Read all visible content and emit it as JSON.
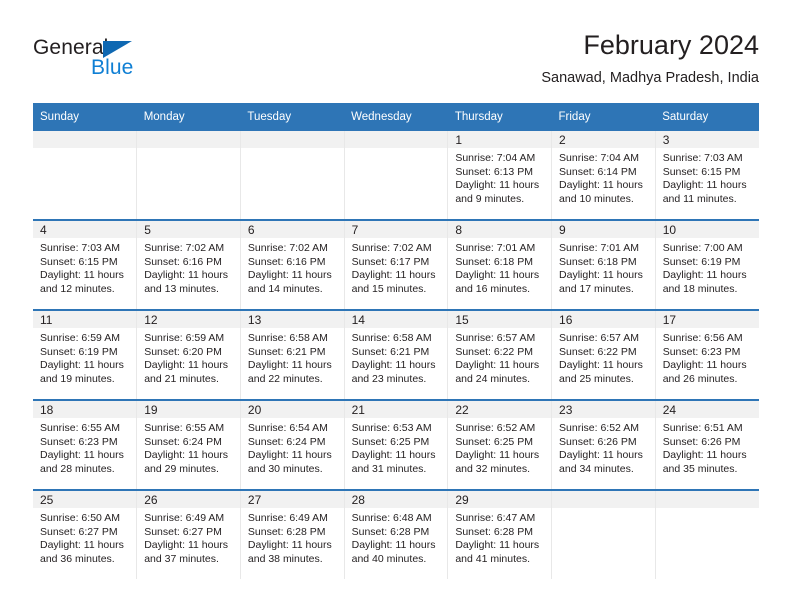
{
  "brand": {
    "word_one": "General",
    "word_two": "Blue",
    "triangle_icon": "blue-triangle-icon",
    "colors": {
      "general_text": "#231f20",
      "blue_text": "#0f7fd4",
      "triangle": "#0f68b2"
    }
  },
  "header": {
    "title": "February 2024",
    "subtitle": "Sanawad, Madhya Pradesh, India"
  },
  "theme": {
    "header_blue": "#2e75b6",
    "daynum_band": "#f1f1f1",
    "text": "#231f20",
    "grid_line": "#e8e8e8"
  },
  "calendar": {
    "weekday_headers": [
      "Sunday",
      "Monday",
      "Tuesday",
      "Wednesday",
      "Thursday",
      "Friday",
      "Saturday"
    ],
    "weeks": [
      [
        {
          "empty": true
        },
        {
          "empty": true
        },
        {
          "empty": true
        },
        {
          "empty": true
        },
        {
          "day": "1",
          "sunrise": "Sunrise: 7:04 AM",
          "sunset": "Sunset: 6:13 PM",
          "daylight": "Daylight: 11 hours and 9 minutes."
        },
        {
          "day": "2",
          "sunrise": "Sunrise: 7:04 AM",
          "sunset": "Sunset: 6:14 PM",
          "daylight": "Daylight: 11 hours and 10 minutes."
        },
        {
          "day": "3",
          "sunrise": "Sunrise: 7:03 AM",
          "sunset": "Sunset: 6:15 PM",
          "daylight": "Daylight: 11 hours and 11 minutes."
        }
      ],
      [
        {
          "day": "4",
          "sunrise": "Sunrise: 7:03 AM",
          "sunset": "Sunset: 6:15 PM",
          "daylight": "Daylight: 11 hours and 12 minutes."
        },
        {
          "day": "5",
          "sunrise": "Sunrise: 7:02 AM",
          "sunset": "Sunset: 6:16 PM",
          "daylight": "Daylight: 11 hours and 13 minutes."
        },
        {
          "day": "6",
          "sunrise": "Sunrise: 7:02 AM",
          "sunset": "Sunset: 6:16 PM",
          "daylight": "Daylight: 11 hours and 14 minutes."
        },
        {
          "day": "7",
          "sunrise": "Sunrise: 7:02 AM",
          "sunset": "Sunset: 6:17 PM",
          "daylight": "Daylight: 11 hours and 15 minutes."
        },
        {
          "day": "8",
          "sunrise": "Sunrise: 7:01 AM",
          "sunset": "Sunset: 6:18 PM",
          "daylight": "Daylight: 11 hours and 16 minutes."
        },
        {
          "day": "9",
          "sunrise": "Sunrise: 7:01 AM",
          "sunset": "Sunset: 6:18 PM",
          "daylight": "Daylight: 11 hours and 17 minutes."
        },
        {
          "day": "10",
          "sunrise": "Sunrise: 7:00 AM",
          "sunset": "Sunset: 6:19 PM",
          "daylight": "Daylight: 11 hours and 18 minutes."
        }
      ],
      [
        {
          "day": "11",
          "sunrise": "Sunrise: 6:59 AM",
          "sunset": "Sunset: 6:19 PM",
          "daylight": "Daylight: 11 hours and 19 minutes."
        },
        {
          "day": "12",
          "sunrise": "Sunrise: 6:59 AM",
          "sunset": "Sunset: 6:20 PM",
          "daylight": "Daylight: 11 hours and 21 minutes."
        },
        {
          "day": "13",
          "sunrise": "Sunrise: 6:58 AM",
          "sunset": "Sunset: 6:21 PM",
          "daylight": "Daylight: 11 hours and 22 minutes."
        },
        {
          "day": "14",
          "sunrise": "Sunrise: 6:58 AM",
          "sunset": "Sunset: 6:21 PM",
          "daylight": "Daylight: 11 hours and 23 minutes."
        },
        {
          "day": "15",
          "sunrise": "Sunrise: 6:57 AM",
          "sunset": "Sunset: 6:22 PM",
          "daylight": "Daylight: 11 hours and 24 minutes."
        },
        {
          "day": "16",
          "sunrise": "Sunrise: 6:57 AM",
          "sunset": "Sunset: 6:22 PM",
          "daylight": "Daylight: 11 hours and 25 minutes."
        },
        {
          "day": "17",
          "sunrise": "Sunrise: 6:56 AM",
          "sunset": "Sunset: 6:23 PM",
          "daylight": "Daylight: 11 hours and 26 minutes."
        }
      ],
      [
        {
          "day": "18",
          "sunrise": "Sunrise: 6:55 AM",
          "sunset": "Sunset: 6:23 PM",
          "daylight": "Daylight: 11 hours and 28 minutes."
        },
        {
          "day": "19",
          "sunrise": "Sunrise: 6:55 AM",
          "sunset": "Sunset: 6:24 PM",
          "daylight": "Daylight: 11 hours and 29 minutes."
        },
        {
          "day": "20",
          "sunrise": "Sunrise: 6:54 AM",
          "sunset": "Sunset: 6:24 PM",
          "daylight": "Daylight: 11 hours and 30 minutes."
        },
        {
          "day": "21",
          "sunrise": "Sunrise: 6:53 AM",
          "sunset": "Sunset: 6:25 PM",
          "daylight": "Daylight: 11 hours and 31 minutes."
        },
        {
          "day": "22",
          "sunrise": "Sunrise: 6:52 AM",
          "sunset": "Sunset: 6:25 PM",
          "daylight": "Daylight: 11 hours and 32 minutes."
        },
        {
          "day": "23",
          "sunrise": "Sunrise: 6:52 AM",
          "sunset": "Sunset: 6:26 PM",
          "daylight": "Daylight: 11 hours and 34 minutes."
        },
        {
          "day": "24",
          "sunrise": "Sunrise: 6:51 AM",
          "sunset": "Sunset: 6:26 PM",
          "daylight": "Daylight: 11 hours and 35 minutes."
        }
      ],
      [
        {
          "day": "25",
          "sunrise": "Sunrise: 6:50 AM",
          "sunset": "Sunset: 6:27 PM",
          "daylight": "Daylight: 11 hours and 36 minutes."
        },
        {
          "day": "26",
          "sunrise": "Sunrise: 6:49 AM",
          "sunset": "Sunset: 6:27 PM",
          "daylight": "Daylight: 11 hours and 37 minutes."
        },
        {
          "day": "27",
          "sunrise": "Sunrise: 6:49 AM",
          "sunset": "Sunset: 6:28 PM",
          "daylight": "Daylight: 11 hours and 38 minutes."
        },
        {
          "day": "28",
          "sunrise": "Sunrise: 6:48 AM",
          "sunset": "Sunset: 6:28 PM",
          "daylight": "Daylight: 11 hours and 40 minutes."
        },
        {
          "day": "29",
          "sunrise": "Sunrise: 6:47 AM",
          "sunset": "Sunset: 6:28 PM",
          "daylight": "Daylight: 11 hours and 41 minutes."
        },
        {
          "empty": true
        },
        {
          "empty": true
        }
      ]
    ]
  }
}
